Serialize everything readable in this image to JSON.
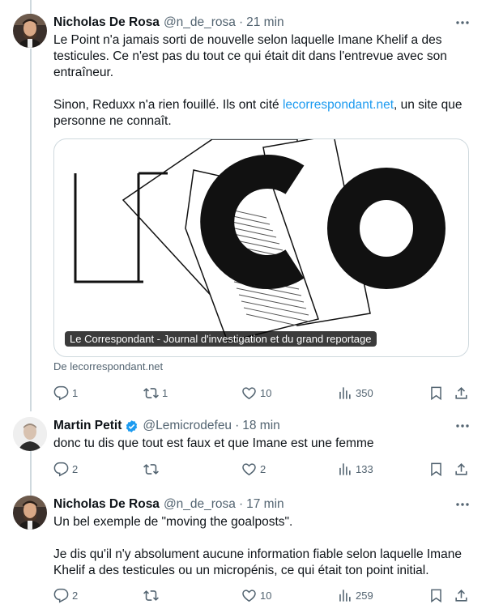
{
  "tweets": [
    {
      "name": "Nicholas De Rosa",
      "handle": "@n_de_rosa",
      "time": "21 min",
      "text_1": "Le Point n'a jamais sorti de nouvelle selon laquelle Imane Khelif a des\ntesticules. Ce n'est pas du tout ce qui était dit dans l'entrevue avec son\nentraîneur.\n\nSinon, Reduxx n'a rien fouillé. Ils ont cité ",
      "link": "lecorrespondant.net",
      "text_2": ", un site que\npersonne ne connaît.",
      "card": {
        "logo_left": "LE",
        "logo_right": "CO",
        "caption": "Le Correspondant - Journal d'investigation et du grand reportage",
        "source": "De lecorrespondant.net"
      },
      "stats": {
        "replies": "1",
        "reposts": "1",
        "likes": "10",
        "views": "350"
      }
    },
    {
      "name": "Martin Petit",
      "handle": "@Lemicrodefeu",
      "time": "18 min",
      "verified": true,
      "text": "donc tu dis que tout est faux et que Imane est une femme",
      "stats": {
        "replies": "2",
        "reposts": "",
        "likes": "2",
        "views": "133"
      }
    },
    {
      "name": "Nicholas De Rosa",
      "handle": "@n_de_rosa",
      "time": "17 min",
      "text": "Un bel exemple de \"moving the goalposts\".\n\nJe dis qu'il n'y absolument aucune information fiable selon laquelle Imane\nKhelif a des testicules ou un micropénis, ce qui était ton point initial.",
      "stats": {
        "replies": "2",
        "reposts": "",
        "likes": "10",
        "views": "259"
      }
    }
  ],
  "icons": {
    "reply": "reply-icon",
    "repost": "repost-icon",
    "like": "heart-icon",
    "views": "views-icon",
    "bookmark": "bookmark-icon",
    "share": "share-icon",
    "more": "more-icon",
    "verified": "verified-badge-icon"
  },
  "colors": {
    "link": "#1d9bf0",
    "muted": "#536471",
    "border": "#cfd9de",
    "text": "#0f1419"
  }
}
